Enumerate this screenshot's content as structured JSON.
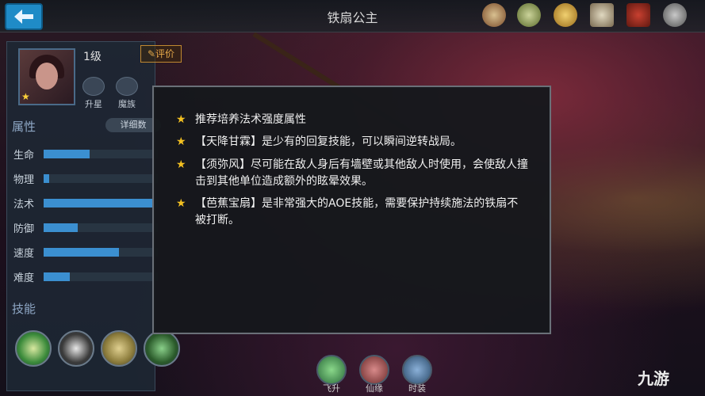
{
  "header": {
    "title": "铁扇公主",
    "icons": [
      "gift-icon",
      "scroll-icon",
      "coin-icon",
      "notice-icon",
      "book-icon",
      "search-icon"
    ]
  },
  "hero": {
    "level": "1级",
    "review_label": "评价",
    "buttons": [
      "升星",
      "魔族"
    ]
  },
  "attributes": {
    "heading": "属性",
    "detail_label": "详细数",
    "stats": [
      {
        "label": "生命",
        "value": 0.4
      },
      {
        "label": "物理",
        "value": 0.05
      },
      {
        "label": "法术",
        "value": 0.95
      },
      {
        "label": "防御",
        "value": 0.3
      },
      {
        "label": "速度",
        "value": 0.66
      },
      {
        "label": "难度",
        "value": 0.23
      }
    ]
  },
  "skills": {
    "heading": "技能",
    "icons": [
      "rain-skill-icon",
      "wind-skill-icon",
      "fan-skill-icon",
      "leaf-skill-icon"
    ]
  },
  "tips": [
    "推荐培养法术强度属性",
    "【天降甘霖】是少有的回复技能，可以瞬间逆转战局。",
    "【须弥风】尽可能在敌人身后有墙壁或其他敌人时使用，会使敌人撞击到其他单位造成额外的眩晕效果。",
    "【芭蕉宝扇】是非常强大的AOE技能，需要保护持续施法的铁扇不被打断。"
  ],
  "bottom_tabs": [
    "飞升",
    "仙缘",
    "时装"
  ],
  "watermark": "九游",
  "colors": {
    "accent": "#1f8bc7",
    "star": "#f3c021",
    "stat_fill": "#3b8fd0",
    "review": "#e4a84a"
  }
}
